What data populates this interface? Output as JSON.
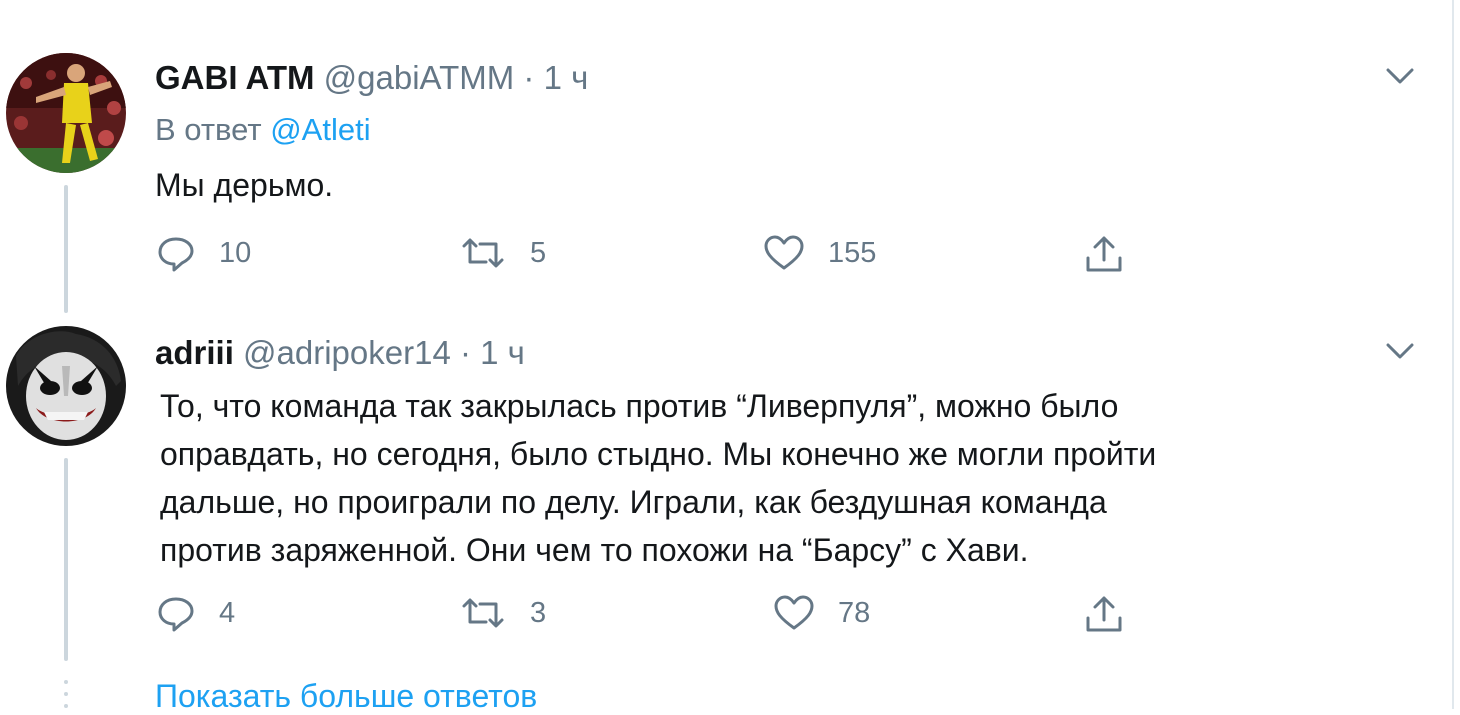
{
  "tweets": [
    {
      "name": "GABI ATM",
      "handle": "@gabiATMM",
      "separator": "·",
      "time": "1 ч",
      "reply_prefix": "В ответ",
      "reply_mention": "@Atleti",
      "text_lines": [
        "Мы дерьмо."
      ],
      "actions": {
        "replies": "10",
        "retweets": "5",
        "likes": "155"
      }
    },
    {
      "name": "adriii",
      "handle": "@adripoker14",
      "separator": "·",
      "time": "1 ч",
      "text_lines": [
        "То, что команда так закрылась против “Ливерпуля”, можно было",
        "оправдать, но сегодня, было стыдно. Мы конечно же могли пройти",
        "дальше, но проиграли по делу. Играли, как бездушная команда",
        "против заряженной. Они чем то похожи на “Барсу” с Хави."
      ],
      "actions": {
        "replies": "4",
        "retweets": "3",
        "likes": "78"
      }
    }
  ],
  "show_more_label": "Показать больше ответов",
  "icons": [
    "reply-icon",
    "retweet-icon",
    "like-icon",
    "share-icon",
    "chevron-down-icon"
  ],
  "colors": {
    "link": "#1da1f2",
    "secondary_text": "#657786",
    "thread_line": "#ccd6dd"
  }
}
